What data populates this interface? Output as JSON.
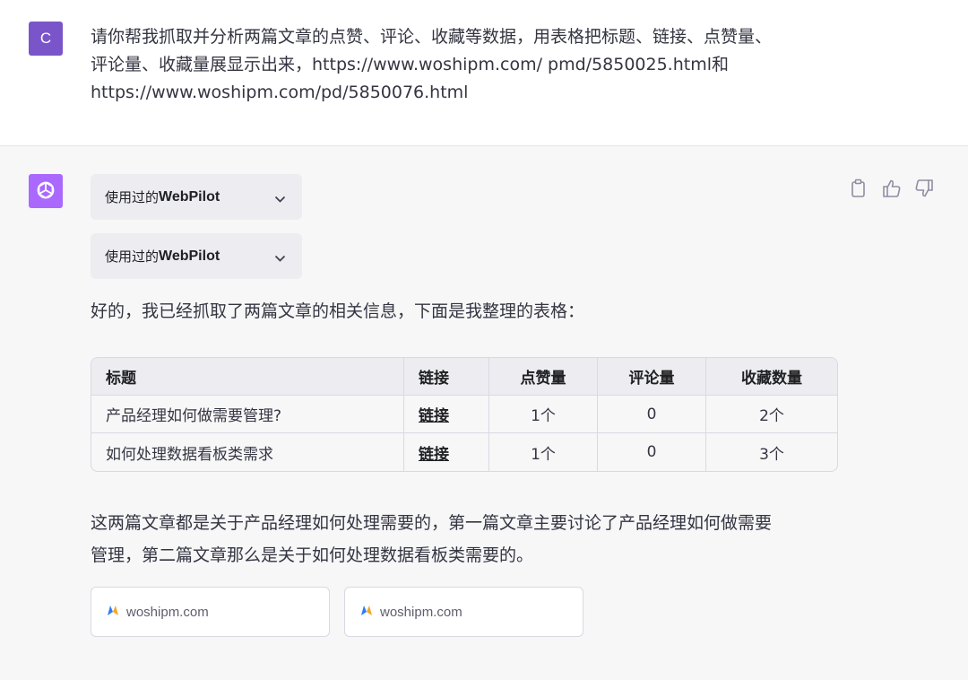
{
  "user": {
    "avatar_letter": "C",
    "message_lines": [
      "请你帮我抓取并分析两篇文章的点赞、评论、收藏等数据，用表格把标题、链接、点赞量、",
      "评论量、收藏量展显示出来，https://www.woshipm.com/ pmd/5850025.html和",
      "https://www.woshipm.com/pd/5850076.html"
    ]
  },
  "assistant": {
    "actions": [
      "copy-icon",
      "thumbs-up-icon",
      "thumbs-down-icon"
    ],
    "plugins": [
      {
        "prefix": "使用过的",
        "name": "WebPilot"
      },
      {
        "prefix": "使用过的",
        "name": "WebPilot"
      }
    ],
    "intro": "好的，我已经抓取了两篇文章的相关信息，下面是我整理的表格：",
    "table": {
      "headers": [
        "标题",
        "链接",
        "点赞量",
        "评论量",
        "收藏数量"
      ],
      "rows": [
        [
          "产品经理如何做需要管理?",
          "链接",
          "1个",
          "0",
          "2个"
        ],
        [
          "如何处理数据看板类需求",
          "链接",
          "1个",
          "0",
          "3个"
        ]
      ]
    },
    "summary_lines": [
      "这两篇文章都是关于产品经理如何处理需要的，第一篇文章主要讨论了产品经理如何做需要",
      "管理，第二篇文章那么是关于如何处理数据看板类需要的。"
    ],
    "sources": [
      {
        "domain": "woshipm.com"
      },
      {
        "domain": "woshipm.com"
      }
    ]
  },
  "colors": {
    "user_avatar": "#7a55c9",
    "gpt_avatar": "#ab68ff",
    "assistant_bg": "#f7f7f8",
    "pill_bg": "#ececf1",
    "border": "#d9d9e3"
  }
}
